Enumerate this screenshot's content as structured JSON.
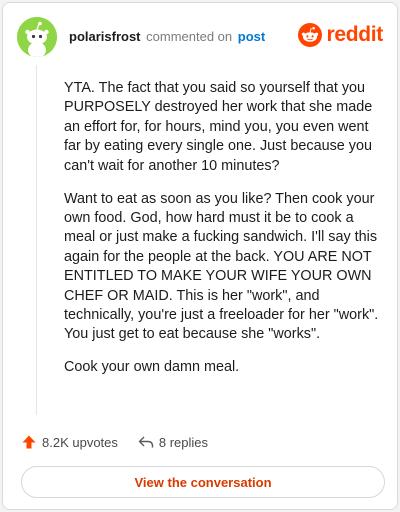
{
  "header": {
    "username": "polarisfrost",
    "verb": "commented on",
    "target": "post",
    "brand": "reddit"
  },
  "comment": {
    "paragraphs": [
      "YTA. The fact that you said so yourself that you PURPOSELY destroyed her work that she made an effort for, for hours, mind you, you even went far by eating every single one. Just because you can't wait for another 10 minutes?",
      "Want to eat as soon as you like? Then cook your own food. God, how hard must it be to cook a meal or just make a fucking sandwich. I'll say this again for the people at the back. YOU ARE NOT ENTITLED TO MAKE YOUR WIFE YOUR OWN CHEF OR MAID. This is her \"work\", and technically, you're just a freeloader for her \"work\". You just get to eat because she \"works\".",
      "Cook your own damn meal."
    ]
  },
  "actions": {
    "upvotes": "8.2K upvotes",
    "replies": "8 replies",
    "view_button": "View the conversation"
  },
  "colors": {
    "brand": "#ff4500",
    "avatar": "#8fd646",
    "link": "#0079d3",
    "button_text": "#d93a00"
  },
  "icons": [
    "snoo-avatar-icon",
    "reddit-logo-icon",
    "upvote-arrow-icon",
    "reply-arrow-icon"
  ]
}
